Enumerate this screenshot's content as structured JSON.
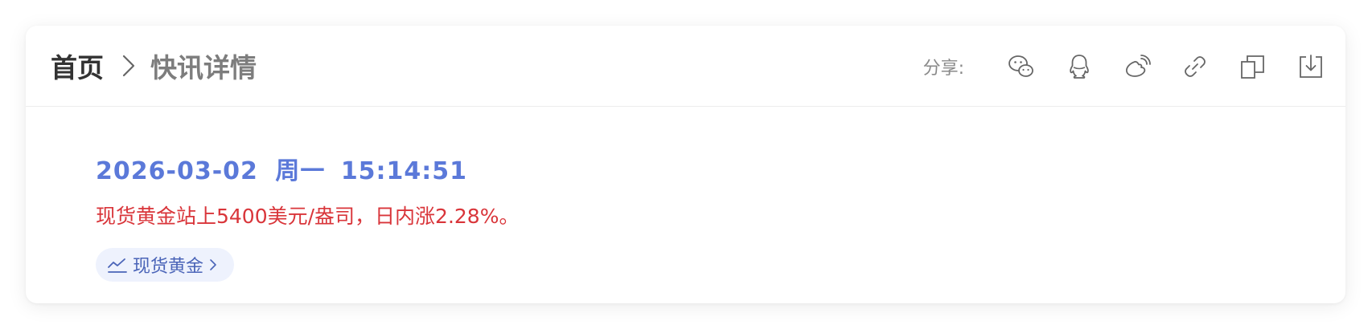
{
  "breadcrumb": {
    "home": "首页",
    "current": "快讯详情"
  },
  "share": {
    "label": "分享:",
    "buttons": [
      {
        "icon": "wechat-icon"
      },
      {
        "icon": "qq-icon"
      },
      {
        "icon": "weibo-icon"
      },
      {
        "icon": "link-icon"
      },
      {
        "icon": "copy-icon"
      },
      {
        "icon": "download-icon"
      }
    ]
  },
  "news": {
    "date": "2026-03-02",
    "weekday": "周一",
    "time": "15:14:51",
    "content": "现货黄金站上5400美元/盎司，日内涨2.28%。",
    "tag": "现货黄金"
  },
  "colors": {
    "datetime": "#5b79d9",
    "content": "#d9353a",
    "tag_bg": "#eef2fd",
    "tag_text": "#4a64b8"
  }
}
